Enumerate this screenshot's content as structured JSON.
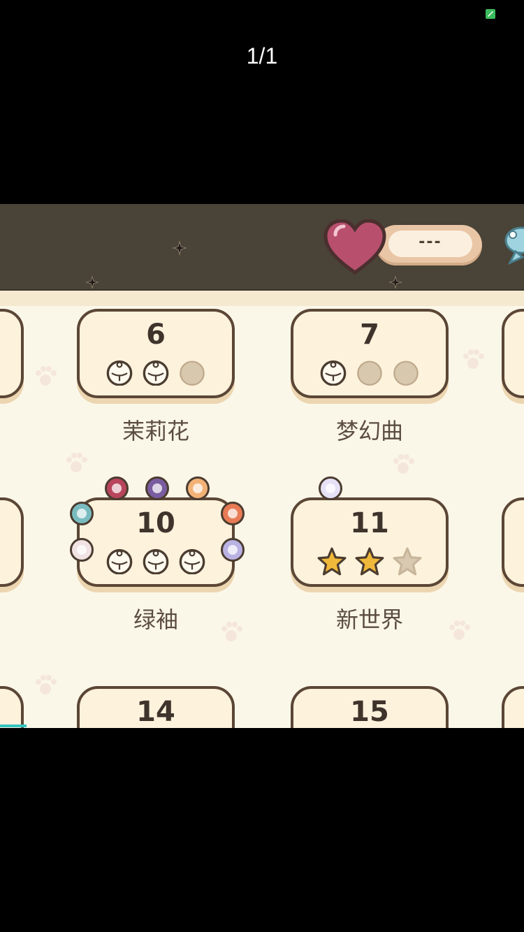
{
  "viewer": {
    "counter": "1/1"
  },
  "hud": {
    "lives_value": "---"
  },
  "levels": [
    {
      "number": "6",
      "title": "茉莉花",
      "rating_type": "bell",
      "earned": 2,
      "total": 3
    },
    {
      "number": "7",
      "title": "梦幻曲",
      "rating_type": "bell",
      "earned": 1,
      "total": 3
    },
    {
      "number": "10",
      "title": "绿袖",
      "rating_type": "bell",
      "earned": 3,
      "total": 3
    },
    {
      "number": "11",
      "title": "新世界",
      "rating_type": "star",
      "earned": 2,
      "total": 3
    },
    {
      "number": "14",
      "title": "",
      "rating_type": "",
      "earned": 0,
      "total": 0
    },
    {
      "number": "15",
      "title": "",
      "rating_type": "",
      "earned": 0,
      "total": 0
    }
  ],
  "colors": {
    "topbar": "#4a4337",
    "card_fill": "#fdf2dc",
    "card_border": "#5b4636",
    "heart": "#b8506d",
    "star": "#f0b83a",
    "bell_off": "#d8c8ae"
  }
}
